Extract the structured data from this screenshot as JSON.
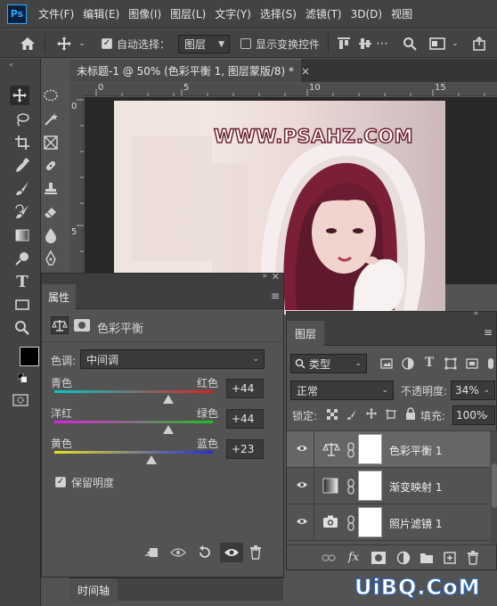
{
  "app": {
    "logo": "Ps"
  },
  "menu": [
    "文件(F)",
    "编辑(E)",
    "图像(I)",
    "图层(L)",
    "文字(Y)",
    "选择(S)",
    "滤镜(T)",
    "3D(D)",
    "视图"
  ],
  "options_bar": {
    "auto_select_label": "自动选择：",
    "auto_select_checked": true,
    "auto_select_target": "图层",
    "show_transform_label": "显示变换控件",
    "show_transform_checked": false
  },
  "document": {
    "tab_title": "未标题-1 @ 50% (色彩平衡 1, 图层蒙版/8) *",
    "close": "×",
    "ruler_top": [
      "0",
      "5",
      "10",
      "15"
    ],
    "ruler_left": [
      "0",
      "5"
    ],
    "watermark": "WWW.PSAHZ.COM"
  },
  "properties": {
    "tab": "属性",
    "adjustment_name": "色彩平衡",
    "tone_label": "色调:",
    "tone_value": "中间调",
    "sliders": [
      {
        "left": "青色",
        "right": "红色",
        "value": "+44",
        "fraction": 0.72,
        "colors": [
          "#00c8c8",
          "#e02020"
        ]
      },
      {
        "left": "洋红",
        "right": "绿色",
        "value": "+44",
        "fraction": 0.72,
        "colors": [
          "#e020e0",
          "#20c020"
        ]
      },
      {
        "left": "黄色",
        "right": "蓝色",
        "value": "+23",
        "fraction": 0.615,
        "colors": [
          "#e8e020",
          "#2030e0"
        ]
      }
    ],
    "preserve_luminosity_label": "保留明度",
    "preserve_luminosity_checked": true
  },
  "layers": {
    "tab": "图层",
    "filter_kind": "类型",
    "blend_mode": "正常",
    "opacity_label": "不透明度:",
    "opacity_value": "34%",
    "lock_label": "锁定:",
    "fill_label": "填充:",
    "fill_value": "100%",
    "items": [
      {
        "name": "色彩平衡 1",
        "icon": "balance-icon",
        "selected": true
      },
      {
        "name": "渐变映射 1",
        "icon": "gradient-map-icon",
        "selected": false
      },
      {
        "name": "照片滤镜 1",
        "icon": "camera-icon",
        "selected": false
      }
    ]
  },
  "timeline": {
    "tab": "时间轴"
  },
  "site_watermark": "UiBQ.CoM",
  "colors": {
    "accent": "#31a8ff",
    "foreground_swatch": "#000000",
    "background_swatch": "#ffffff"
  }
}
